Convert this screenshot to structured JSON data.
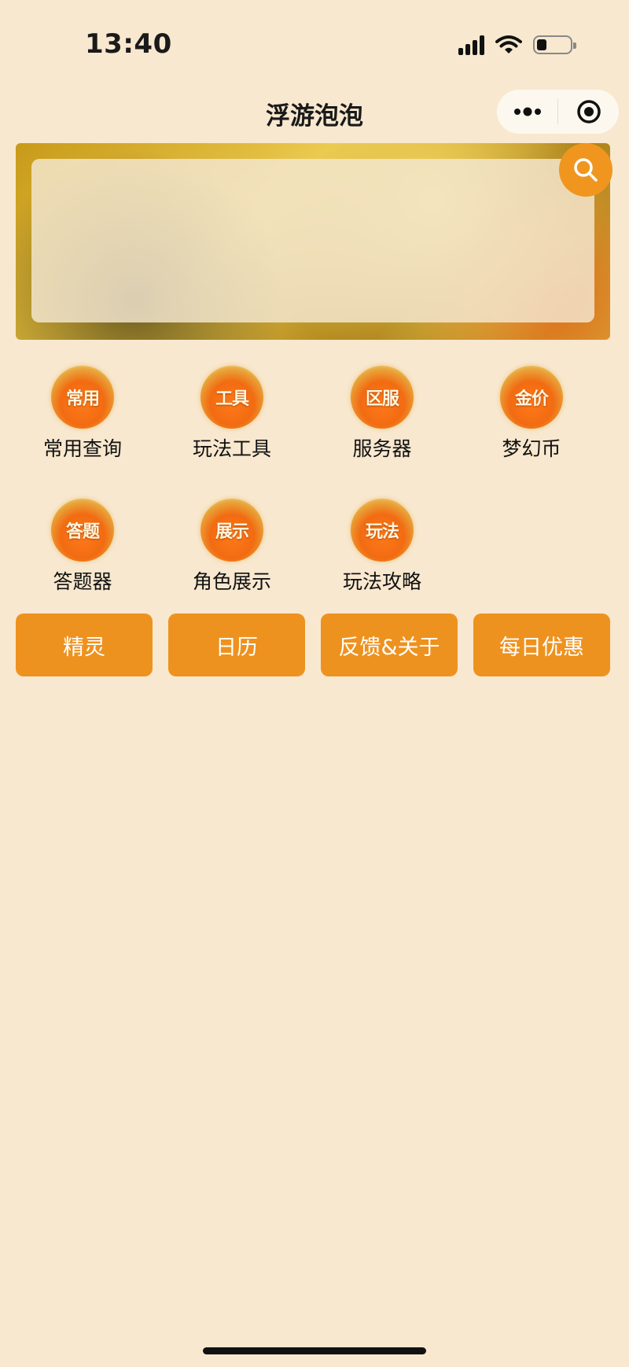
{
  "status": {
    "time": "13:40"
  },
  "nav": {
    "title": "浮游泡泡"
  },
  "grid": [
    {
      "badge": "常用",
      "label": "常用查询"
    },
    {
      "badge": "工具",
      "label": "玩法工具"
    },
    {
      "badge": "区服",
      "label": "服务器"
    },
    {
      "badge": "金价",
      "label": "梦幻币"
    },
    {
      "badge": "答题",
      "label": "答题器"
    },
    {
      "badge": "展示",
      "label": "角色展示"
    },
    {
      "badge": "玩法",
      "label": "玩法攻略"
    }
  ],
  "buttons": [
    {
      "label": "精灵"
    },
    {
      "label": "日历"
    },
    {
      "label": "反馈&关于"
    },
    {
      "label": "每日优惠"
    }
  ],
  "colors": {
    "background": "#f8e8cf",
    "accent": "#ee921f"
  },
  "icons": [
    "signal-icon",
    "wifi-icon",
    "battery-icon",
    "more-icon",
    "target-icon",
    "search-icon"
  ]
}
